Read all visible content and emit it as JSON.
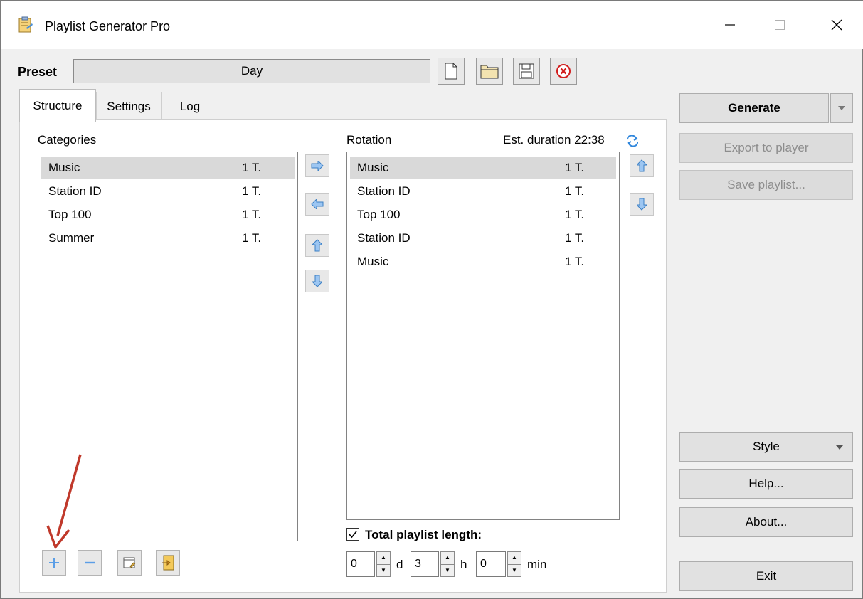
{
  "window": {
    "title": "Playlist Generator Pro"
  },
  "preset": {
    "label": "Preset",
    "value": "Day"
  },
  "tabs": [
    {
      "label": "Structure"
    },
    {
      "label": "Settings"
    },
    {
      "label": "Log"
    }
  ],
  "categories": {
    "heading": "Categories",
    "items": [
      {
        "name": "Music",
        "count": "1 T."
      },
      {
        "name": "Station ID",
        "count": "1 T."
      },
      {
        "name": "Top 100",
        "count": "1 T."
      },
      {
        "name": "Summer",
        "count": "1 T."
      }
    ]
  },
  "rotation": {
    "heading": "Rotation",
    "est_duration": "Est. duration 22:38",
    "items": [
      {
        "name": "Music",
        "count": "1 T."
      },
      {
        "name": "Station ID",
        "count": "1 T."
      },
      {
        "name": "Top 100",
        "count": "1 T."
      },
      {
        "name": "Station ID",
        "count": "1 T."
      },
      {
        "name": "Music",
        "count": "1 T."
      }
    ]
  },
  "length": {
    "label": "Total playlist length:",
    "checked": true,
    "days": "0",
    "days_unit": "d",
    "hours": "3",
    "hours_unit": "h",
    "minutes": "0",
    "minutes_unit": "min"
  },
  "sidebar": {
    "generate": "Generate",
    "export": "Export to player",
    "save_playlist": "Save playlist...",
    "style": "Style",
    "help": "Help...",
    "about": "About...",
    "exit": "Exit"
  },
  "colors": {
    "accent_blue": "#3b8de0",
    "annotation_arrow": "#c0392b",
    "selected_row": "#d9d9d9"
  }
}
